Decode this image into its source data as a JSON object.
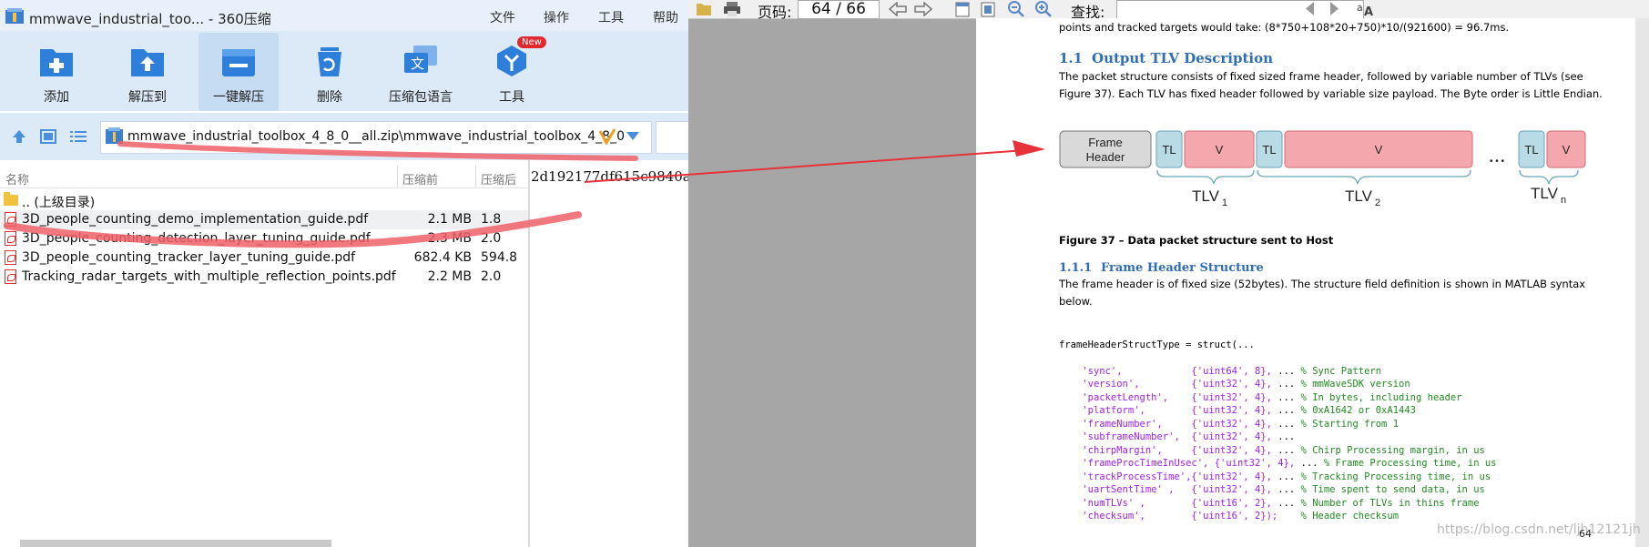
{
  "zip": {
    "title": "mmwave_industrial_too... - 360压缩",
    "menu": [
      "文件",
      "操作",
      "工具",
      "帮助"
    ],
    "tools": [
      {
        "label": "添加",
        "icon": "add-icon"
      },
      {
        "label": "解压到",
        "icon": "extract-to-icon"
      },
      {
        "label": "一键解压",
        "icon": "one-click-extract-icon"
      },
      {
        "label": "删除",
        "icon": "delete-icon"
      },
      {
        "label": "压缩包语言",
        "icon": "archive-language-icon"
      },
      {
        "label": "工具",
        "icon": "tools-icon"
      }
    ],
    "new_badge": "New",
    "path": "mmwave_industrial_toolbox_4_8_0__all.zip\\mmwave_industrial_toolbox_4_8_0",
    "columns": {
      "name": "名称",
      "size": "压缩前",
      "packed": "压缩后"
    },
    "rows": [
      {
        "name": ".. (上级目录)",
        "size": "",
        "packed": "",
        "icon": "folder-icon"
      },
      {
        "name": "3D_people_counting_demo_implementation_guide.pdf",
        "size": "2.1 MB",
        "packed": "1.8",
        "icon": "pdf-icon"
      },
      {
        "name": "3D_people_counting_detection_layer_tuning_guide.pdf",
        "size": "2.3 MB",
        "packed": "2.0",
        "icon": "pdf-icon"
      },
      {
        "name": "3D_people_counting_tracker_layer_tuning_guide.pdf",
        "size": "682.4 KB",
        "packed": "594.8",
        "icon": "pdf-icon"
      },
      {
        "name": "Tracking_radar_targets_with_multiple_reflection_points.pdf",
        "size": "2.2 MB",
        "packed": "2.0",
        "icon": "pdf-icon"
      }
    ],
    "hash": "2d192177df615c9840a"
  },
  "pdf": {
    "page_label": "页码:",
    "page_value": "64 / 66",
    "find_label": "查找:",
    "line0": "points and tracked targets would take: (8*750+108*20+750)*10/(921600) = 96.7ms.",
    "sec_num": "1.1",
    "sec_title": "Output TLV Description",
    "para1a": "The packet structure consists of fixed sized frame header, followed by variable number of TLVs (see",
    "para1b": "Figure 37). Each TLV has fixed header followed by variable size payload. The Byte order is Little Endian.",
    "diagram": {
      "frame_header": [
        "Frame",
        "Header"
      ],
      "tl": "TL",
      "v": "V",
      "dots": "• • •",
      "tlv1": "TLV",
      "tlv2": "TLV",
      "tlvn": "TLV",
      "sub1": "1",
      "sub2": "2",
      "subn": "n"
    },
    "fig_caption": "Figure 37 – Data packet structure sent to Host",
    "sub_num": "1.1.1",
    "sub_title": "Frame Header Structure",
    "para2a": "The frame header is of fixed size (52bytes). The structure field definition is shown in MATLAB syntax",
    "para2b": "below.",
    "code_first": "frameHeaderStructType = struct(...",
    "code_lines": [
      {
        "name": "'sync',",
        "pad": "            ",
        "type": "{'uint64', 8},",
        "cm": "% Sync Pattern"
      },
      {
        "name": "'version',",
        "pad": "         ",
        "type": "{'uint32', 4},",
        "cm": "% mmWaveSDK version"
      },
      {
        "name": "'packetLength',",
        "pad": "    ",
        "type": "{'uint32', 4},",
        "cm": "% In bytes, including header"
      },
      {
        "name": "'platform',",
        "pad": "        ",
        "type": "{'uint32', 4},",
        "cm": "% 0xA1642 or 0xA1443"
      },
      {
        "name": "'frameNumber',",
        "pad": "     ",
        "type": "{'uint32', 4},",
        "cm": "% Starting from 1"
      },
      {
        "name": "'subframeNumber',",
        "pad": "  ",
        "type": "{'uint32', 4},",
        "cm": ""
      },
      {
        "name": "'chirpMargin',",
        "pad": "     ",
        "type": "{'uint32', 4},",
        "cm": "% Chirp Processing margin, in us"
      },
      {
        "name": "'frameProcTimeInUsec',",
        "pad": " ",
        "type": "{'uint32', 4},",
        "cm": "% Frame Processing time, in us"
      },
      {
        "name": "'trackProcessTime',",
        "pad": "",
        "type": "{'uint32', 4},",
        "cm": "% Tracking Processing time, in us"
      },
      {
        "name": "'uartSentTime' ,",
        "pad": "   ",
        "type": "{'uint32', 4},",
        "cm": "% Time spent to send data, in us"
      },
      {
        "name": "'numTLVs' ,",
        "pad": "        ",
        "type": "{'uint16', 2},",
        "cm": "% Number of TLVs in thins frame"
      },
      {
        "name": "'checksum',",
        "pad": "        ",
        "type": "{'uint16', 2});",
        "cm": "% Header checksum"
      }
    ],
    "page_number": "64",
    "watermark": "https://blog.csdn.net/ljh12121jh"
  },
  "colors": {
    "annotation_red": "#e8323a",
    "highlight_red": "#f0606a",
    "tl_box": "#b9dbe6",
    "v_box": "#f4a8ad",
    "header_box": "#d9d9d9"
  }
}
